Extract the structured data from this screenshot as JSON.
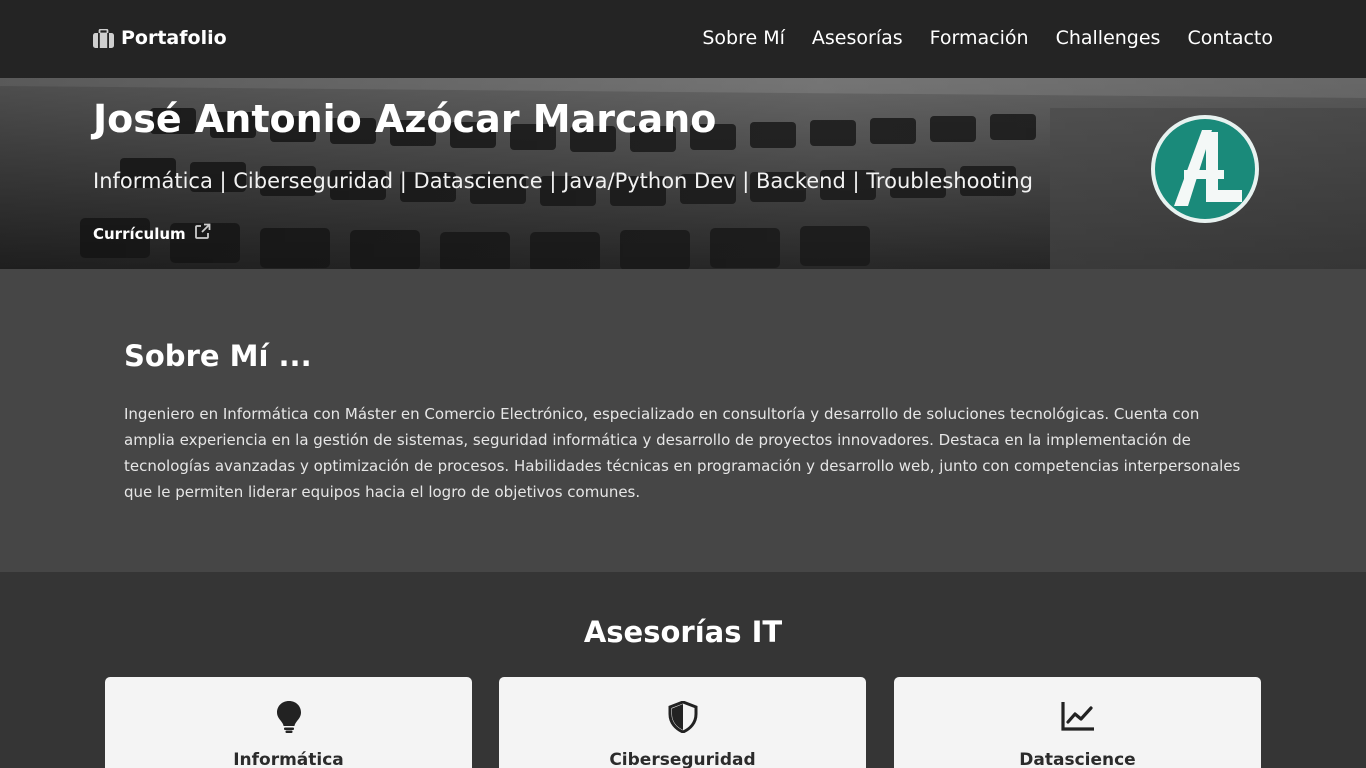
{
  "navbar": {
    "brand": "Portafolio",
    "brand_icon": "briefcase-icon",
    "links": [
      "Sobre Mí",
      "Asesorías",
      "Formación",
      "Challenges",
      "Contacto"
    ]
  },
  "hero": {
    "name": "José Antonio Azócar Marcano",
    "subtitle": "Informática | Ciberseguridad | Datascience | Java/Python Dev | Backend | Troubleshooting",
    "cv_label": "Currículum",
    "cv_icon": "external-link-icon",
    "logo_text": "AL",
    "logo_color": "#1a8a7a"
  },
  "about": {
    "title": "Sobre Mí ...",
    "text": "Ingeniero en Informática con Máster en Comercio Electrónico, especializado en consultoría y desarrollo de soluciones tecnológicas. Cuenta con amplia experiencia en la gestión de sistemas, seguridad informática y desarrollo de proyectos innovadores. Destaca en la implementación de tecnologías avanzadas y optimización de procesos. Habilidades técnicas en programación y desarrollo web, junto con competencias interpersonales que le permiten liderar equipos hacia el logro de objetivos comunes."
  },
  "services": {
    "title": "Asesorías IT",
    "cards": [
      {
        "title": "Informática",
        "icon": "lightbulb-icon"
      },
      {
        "title": "Ciberseguridad",
        "icon": "shield-icon"
      },
      {
        "title": "Datascience",
        "icon": "chart-line-icon"
      }
    ]
  },
  "colors": {
    "navbar_bg": "#242424",
    "about_bg": "#464646",
    "services_bg": "#353535",
    "card_bg": "#f4f4f4"
  }
}
